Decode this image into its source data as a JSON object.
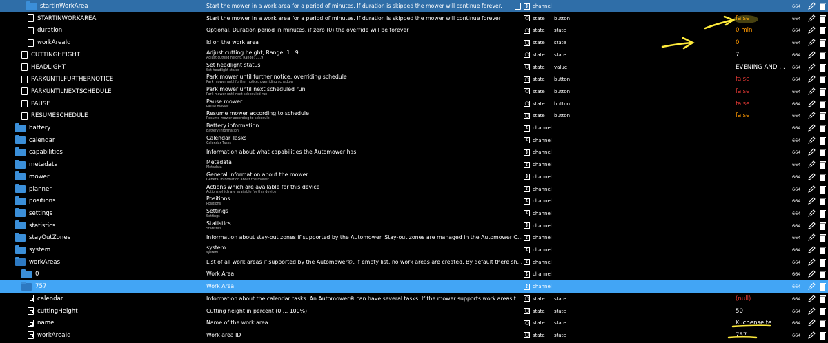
{
  "colors": {
    "selected_row": "#42a5f5",
    "folder": "#3b8fd9",
    "value_false": "#e53935",
    "value_warn": "#ff9800",
    "value_default": "#ffffff",
    "annotation": "#ffeb3b"
  },
  "rows": [
    {
      "name": "startInWorkArea",
      "indent": 38,
      "icon": "folder",
      "desc": "Start the mower in a work area for a period of minutes. If duration is skipped the mower will continue forever.",
      "sub": "",
      "kind": "channel",
      "kind_icon": "channel",
      "role": "",
      "value": "",
      "value_color": "default",
      "num": "664",
      "extra_copy_icon": true
    },
    {
      "name": "STARTINWORKAREA",
      "indent": 40,
      "icon": "doc",
      "desc": "Start the mower in a work area for a period of minutes. If duration is skipped the mower will continue forever",
      "sub": "",
      "kind": "state",
      "kind_icon": "state",
      "role": "button",
      "value": "false",
      "value_color": "warn",
      "num": "664"
    },
    {
      "name": "duration",
      "indent": 40,
      "icon": "doc",
      "desc": "Optional. Duration period in minutes, if zero (0) the override will be forever",
      "sub": "",
      "kind": "state",
      "kind_icon": "state",
      "role": "state",
      "value": "0 min",
      "value_color": "warn",
      "num": "664"
    },
    {
      "name": "workAreaId",
      "indent": 40,
      "icon": "doc",
      "desc": "Id on the work area",
      "sub": "",
      "kind": "state",
      "kind_icon": "state",
      "role": "state",
      "value": "0",
      "value_color": "warn",
      "num": "664"
    },
    {
      "name": "CUTTINGHEIGHT",
      "indent": 31,
      "icon": "doc",
      "desc": "Adjust cutting height, Range: 1...9",
      "sub": "Adjust cutting height, Range: 1...9",
      "kind": "state",
      "kind_icon": "state",
      "role": "state",
      "value": "7",
      "value_color": "default",
      "num": "664"
    },
    {
      "name": "HEADLIGHT",
      "indent": 31,
      "icon": "doc",
      "desc": "Set headlight status",
      "sub": "Set headlight status",
      "kind": "state",
      "kind_icon": "state",
      "role": "value",
      "value": "EVENING AND NIGHT",
      "value_color": "default",
      "num": "664"
    },
    {
      "name": "PARKUNTILFURTHERNOTICE",
      "indent": 31,
      "icon": "doc",
      "desc": "Park mower until further notice, overriding schedule",
      "sub": "Park mower until further notice, overriding schedule",
      "kind": "state",
      "kind_icon": "state",
      "role": "button",
      "value": "false",
      "value_color": "false",
      "num": "664"
    },
    {
      "name": "PARKUNTILNEXTSCHEDULE",
      "indent": 31,
      "icon": "doc",
      "desc": "Park mower until next scheduled run",
      "sub": "Park mower until next scheduled run",
      "kind": "state",
      "kind_icon": "state",
      "role": "button",
      "value": "false",
      "value_color": "false",
      "num": "664"
    },
    {
      "name": "PAUSE",
      "indent": 31,
      "icon": "doc",
      "desc": "Pause mower",
      "sub": "Pause mower",
      "kind": "state",
      "kind_icon": "state",
      "role": "button",
      "value": "false",
      "value_color": "false",
      "num": "664"
    },
    {
      "name": "RESUMESCHEDULE",
      "indent": 31,
      "icon": "doc",
      "desc": "Resume mower according to schedule",
      "sub": "Resume mower according to schedule",
      "kind": "state",
      "kind_icon": "state",
      "role": "button",
      "value": "false",
      "value_color": "warn",
      "num": "664"
    },
    {
      "name": "battery",
      "indent": 22,
      "icon": "folder",
      "desc": "Battery information",
      "sub": "Battery information",
      "kind": "channel",
      "kind_icon": "channel",
      "role": "",
      "value": "",
      "value_color": "default",
      "num": "664"
    },
    {
      "name": "calendar",
      "indent": 22,
      "icon": "folder",
      "desc": "Calendar Tasks",
      "sub": "Calendar Tasks",
      "kind": "channel",
      "kind_icon": "channel",
      "role": "",
      "value": "",
      "value_color": "default",
      "num": "664"
    },
    {
      "name": "capabilities",
      "indent": 22,
      "icon": "folder",
      "desc": "Information about what capabilities the Automower has",
      "sub": "",
      "kind": "channel",
      "kind_icon": "channel",
      "role": "",
      "value": "",
      "value_color": "default",
      "num": "664"
    },
    {
      "name": "metadata",
      "indent": 22,
      "icon": "folder",
      "desc": "Metadata",
      "sub": "Metadata",
      "kind": "channel",
      "kind_icon": "channel",
      "role": "",
      "value": "",
      "value_color": "default",
      "num": "664"
    },
    {
      "name": "mower",
      "indent": 22,
      "icon": "folder",
      "desc": "General information about the mower",
      "sub": "General information about the mower",
      "kind": "channel",
      "kind_icon": "channel",
      "role": "",
      "value": "",
      "value_color": "default",
      "num": "664"
    },
    {
      "name": "planner",
      "indent": 22,
      "icon": "folder",
      "desc": "Actions which are available for this device",
      "sub": "Actions which are available for this device",
      "kind": "channel",
      "kind_icon": "channel",
      "role": "",
      "value": "",
      "value_color": "default",
      "num": "664"
    },
    {
      "name": "positions",
      "indent": 22,
      "icon": "folder",
      "desc": "Positions",
      "sub": "Positions",
      "kind": "channel",
      "kind_icon": "channel",
      "role": "",
      "value": "",
      "value_color": "default",
      "num": "664"
    },
    {
      "name": "settings",
      "indent": 22,
      "icon": "folder",
      "desc": "Settings",
      "sub": "Settings",
      "kind": "channel",
      "kind_icon": "channel",
      "role": "",
      "value": "",
      "value_color": "default",
      "num": "664"
    },
    {
      "name": "statistics",
      "indent": 22,
      "icon": "folder",
      "desc": "Statistics",
      "sub": "Statistics",
      "kind": "channel",
      "kind_icon": "channel",
      "role": "",
      "value": "",
      "value_color": "default",
      "num": "664"
    },
    {
      "name": "stayOutZones",
      "indent": 22,
      "icon": "folder",
      "desc": "Information about stay-out zones if supported by the Automower. Stay-out zones are managed in the Automower Connect app. To cre...",
      "sub": "",
      "kind": "channel",
      "kind_icon": "channel",
      "role": "",
      "value": "",
      "value_color": "default",
      "num": "664"
    },
    {
      "name": "system",
      "indent": 22,
      "icon": "folder",
      "desc": "system",
      "sub": "system",
      "kind": "channel",
      "kind_icon": "channel",
      "role": "",
      "value": "",
      "value_color": "default",
      "num": "664"
    },
    {
      "name": "workAreas",
      "indent": 22,
      "icon": "folder-open",
      "desc": "List of all work areas if supported by the Automower®. If empty list, no work areas are created. By default there should be a default w...",
      "sub": "",
      "kind": "channel",
      "kind_icon": "channel",
      "role": "",
      "value": "",
      "value_color": "default",
      "num": "664"
    },
    {
      "name": "0",
      "indent": 31,
      "icon": "folder",
      "desc": "Work Area",
      "sub": "",
      "kind": "channel",
      "kind_icon": "channel",
      "role": "",
      "value": "",
      "value_color": "default",
      "num": "664"
    },
    {
      "name": "757",
      "indent": 31,
      "icon": "folder-open",
      "desc": "Work Area",
      "sub": "",
      "kind": "channel",
      "kind_icon": "channel",
      "role": "",
      "value": "",
      "value_color": "default",
      "num": "664",
      "selected": true
    },
    {
      "name": "calendar",
      "indent": 40,
      "icon": "doc-struct",
      "desc": "Information about the calendar tasks. An Automower® can have several tasks. If the mower supports work areas the property workAre...",
      "sub": "",
      "kind": "state",
      "kind_icon": "state",
      "role": "state",
      "value": "(null)",
      "value_color": "false",
      "num": "664"
    },
    {
      "name": "cuttingHeight",
      "indent": 40,
      "icon": "doc-struct",
      "desc": "Cutting height in percent (0 ... 100%)",
      "sub": "",
      "kind": "state",
      "kind_icon": "state",
      "role": "state",
      "value": "50",
      "value_color": "default",
      "num": "664"
    },
    {
      "name": "name",
      "indent": 40,
      "icon": "doc-struct",
      "desc": "Name of the work area",
      "sub": "",
      "kind": "state",
      "kind_icon": "state",
      "role": "state",
      "value": "Küchenseite",
      "value_color": "default",
      "num": "664"
    },
    {
      "name": "workAreaId",
      "indent": 40,
      "icon": "doc-struct",
      "desc": "Work area ID",
      "sub": "",
      "kind": "state",
      "kind_icon": "state",
      "role": "state",
      "value": "757",
      "value_color": "default",
      "num": "664"
    }
  ]
}
